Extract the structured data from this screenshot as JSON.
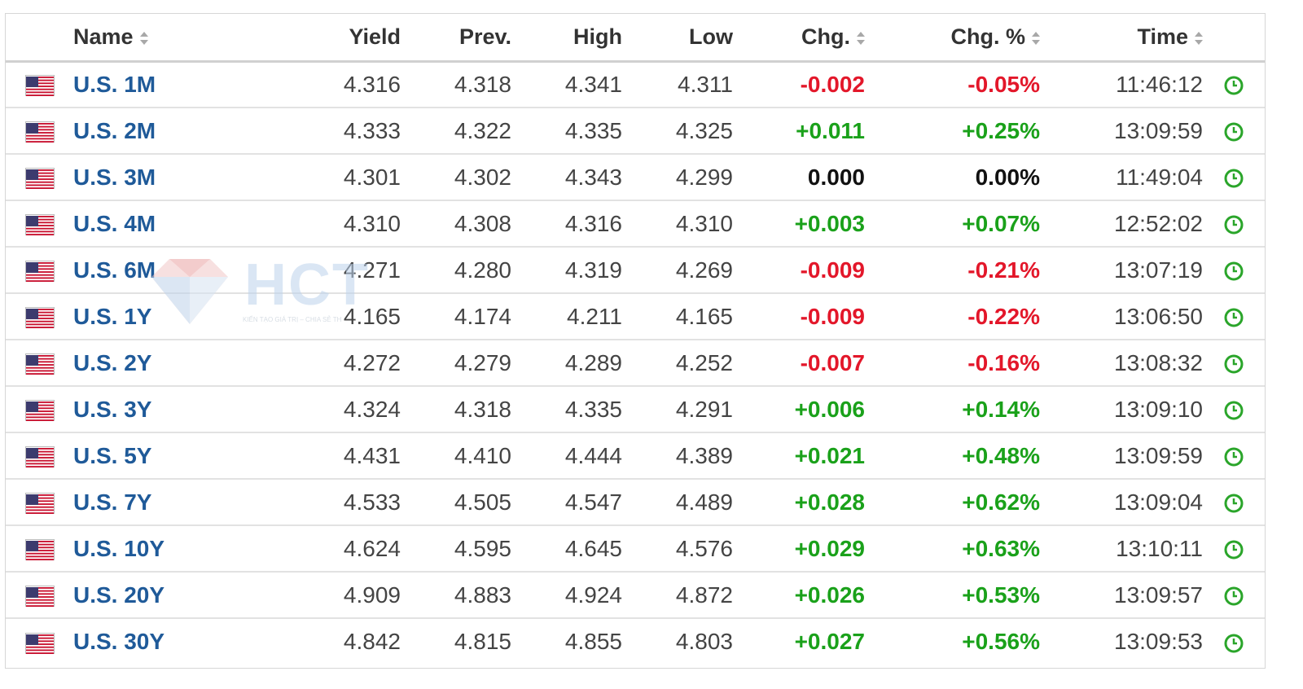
{
  "colors": {
    "negative": "#e3172a",
    "positive": "#1aa11a",
    "neutral": "#111111",
    "name_link": "#1f5a99",
    "clock_icon": "#2aa52a"
  },
  "header": {
    "name": "Name",
    "yield": "Yield",
    "prev": "Prev.",
    "high": "High",
    "low": "Low",
    "chg": "Chg.",
    "chg_pct": "Chg. %",
    "time": "Time"
  },
  "watermark": {
    "text": "HCT",
    "tagline": "KIẾN TẠO GIÁ TRỊ – CHIA SẺ TH"
  },
  "rows": [
    {
      "name": "U.S. 1M",
      "yield": "4.316",
      "prev": "4.318",
      "high": "4.341",
      "low": "4.311",
      "chg": "-0.002",
      "chg_pct": "-0.05%",
      "time": "11:46:12",
      "dir": "neg",
      "flag_icon": "us-flag-icon",
      "clock_icon": "clock-icon"
    },
    {
      "name": "U.S. 2M",
      "yield": "4.333",
      "prev": "4.322",
      "high": "4.335",
      "low": "4.325",
      "chg": "+0.011",
      "chg_pct": "+0.25%",
      "time": "13:09:59",
      "dir": "pos",
      "flag_icon": "us-flag-icon",
      "clock_icon": "clock-icon"
    },
    {
      "name": "U.S. 3M",
      "yield": "4.301",
      "prev": "4.302",
      "high": "4.343",
      "low": "4.299",
      "chg": "0.000",
      "chg_pct": "0.00%",
      "time": "11:49:04",
      "dir": "zero",
      "flag_icon": "us-flag-icon",
      "clock_icon": "clock-icon"
    },
    {
      "name": "U.S. 4M",
      "yield": "4.310",
      "prev": "4.308",
      "high": "4.316",
      "low": "4.310",
      "chg": "+0.003",
      "chg_pct": "+0.07%",
      "time": "12:52:02",
      "dir": "pos",
      "flag_icon": "us-flag-icon",
      "clock_icon": "clock-icon"
    },
    {
      "name": "U.S. 6M",
      "yield": "4.271",
      "prev": "4.280",
      "high": "4.319",
      "low": "4.269",
      "chg": "-0.009",
      "chg_pct": "-0.21%",
      "time": "13:07:19",
      "dir": "neg",
      "flag_icon": "us-flag-icon",
      "clock_icon": "clock-icon"
    },
    {
      "name": "U.S. 1Y",
      "yield": "4.165",
      "prev": "4.174",
      "high": "4.211",
      "low": "4.165",
      "chg": "-0.009",
      "chg_pct": "-0.22%",
      "time": "13:06:50",
      "dir": "neg",
      "flag_icon": "us-flag-icon",
      "clock_icon": "clock-icon"
    },
    {
      "name": "U.S. 2Y",
      "yield": "4.272",
      "prev": "4.279",
      "high": "4.289",
      "low": "4.252",
      "chg": "-0.007",
      "chg_pct": "-0.16%",
      "time": "13:08:32",
      "dir": "neg",
      "flag_icon": "us-flag-icon",
      "clock_icon": "clock-icon"
    },
    {
      "name": "U.S. 3Y",
      "yield": "4.324",
      "prev": "4.318",
      "high": "4.335",
      "low": "4.291",
      "chg": "+0.006",
      "chg_pct": "+0.14%",
      "time": "13:09:10",
      "dir": "pos",
      "flag_icon": "us-flag-icon",
      "clock_icon": "clock-icon"
    },
    {
      "name": "U.S. 5Y",
      "yield": "4.431",
      "prev": "4.410",
      "high": "4.444",
      "low": "4.389",
      "chg": "+0.021",
      "chg_pct": "+0.48%",
      "time": "13:09:59",
      "dir": "pos",
      "flag_icon": "us-flag-icon",
      "clock_icon": "clock-icon"
    },
    {
      "name": "U.S. 7Y",
      "yield": "4.533",
      "prev": "4.505",
      "high": "4.547",
      "low": "4.489",
      "chg": "+0.028",
      "chg_pct": "+0.62%",
      "time": "13:09:04",
      "dir": "pos",
      "flag_icon": "us-flag-icon",
      "clock_icon": "clock-icon"
    },
    {
      "name": "U.S. 10Y",
      "yield": "4.624",
      "prev": "4.595",
      "high": "4.645",
      "low": "4.576",
      "chg": "+0.029",
      "chg_pct": "+0.63%",
      "time": "13:10:11",
      "dir": "pos",
      "flag_icon": "us-flag-icon",
      "clock_icon": "clock-icon"
    },
    {
      "name": "U.S. 20Y",
      "yield": "4.909",
      "prev": "4.883",
      "high": "4.924",
      "low": "4.872",
      "chg": "+0.026",
      "chg_pct": "+0.53%",
      "time": "13:09:57",
      "dir": "pos",
      "flag_icon": "us-flag-icon",
      "clock_icon": "clock-icon"
    },
    {
      "name": "U.S. 30Y",
      "yield": "4.842",
      "prev": "4.815",
      "high": "4.855",
      "low": "4.803",
      "chg": "+0.027",
      "chg_pct": "+0.56%",
      "time": "13:09:53",
      "dir": "pos",
      "flag_icon": "us-flag-icon",
      "clock_icon": "clock-icon"
    }
  ]
}
